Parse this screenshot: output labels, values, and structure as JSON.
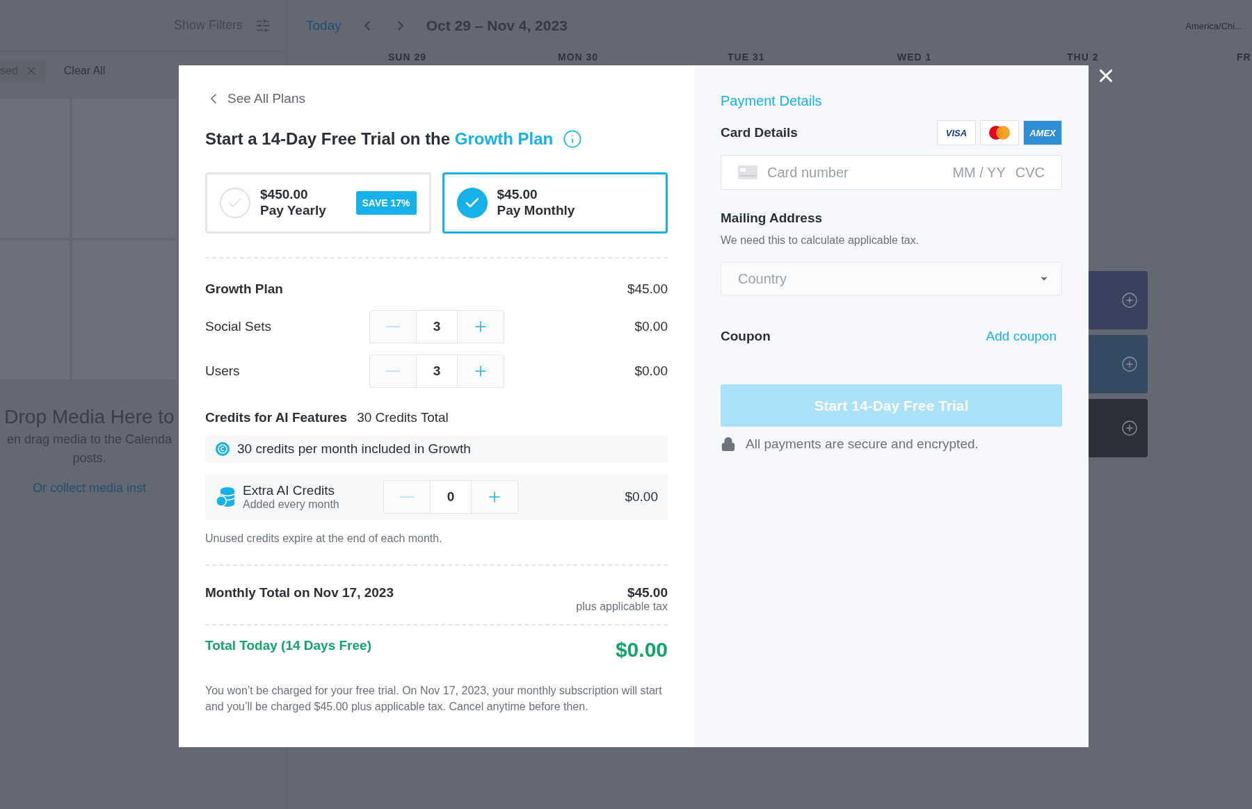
{
  "background": {
    "sidebar": {
      "show_filters": "Show Filters",
      "chip": "sed",
      "clear_all": "Clear All",
      "drop_title": "Drop Media Here to",
      "drop_lines": [
        "en drag media to the Calenda",
        "posts."
      ],
      "collect_link": "Or collect media inst"
    },
    "toolbar": {
      "today": "Today",
      "range": "Oct 29 – Nov 4, 2023",
      "timezone": "America/Chi..."
    },
    "days": [
      "SUN 29",
      "MON 30",
      "TUE 31",
      "WED 1",
      "THU 2",
      "FR"
    ],
    "slots": [
      {
        "color": "#3b4260"
      },
      {
        "color": "#344a63"
      },
      {
        "color": "#2d3038"
      }
    ]
  },
  "modal": {
    "back_link": "See All Plans",
    "title": "Start a 14-Day Free Trial on the",
    "title_highlight": "Growth Plan",
    "billing_options": [
      {
        "price": "$450.00",
        "label": "Pay Yearly",
        "badge": "SAVE 17%",
        "selected": false
      },
      {
        "price": "$45.00",
        "label": "Pay Monthly",
        "selected": true
      }
    ],
    "line_items": [
      {
        "kind": "plan",
        "label": "Growth Plan",
        "amount": "$45.00"
      },
      {
        "kind": "stepper",
        "label": "Social Sets",
        "quantity": "3",
        "amount": "$0.00"
      },
      {
        "kind": "stepper",
        "label": "Users",
        "quantity": "3",
        "amount": "$0.00"
      }
    ],
    "credits": {
      "title": "Credits for AI Features",
      "total": "30 Credits Total",
      "included": "30 credits per month included in Growth",
      "extra": {
        "title": "Extra AI Credits",
        "subtitle": "Added every month",
        "quantity": "0",
        "amount": "$0.00"
      },
      "note": "Unused credits expire at the end of each month."
    },
    "monthly_total": {
      "label": "Monthly Total on Nov 17, 2023",
      "amount": "$45.00",
      "note": "plus applicable tax"
    },
    "total_today": {
      "label": "Total Today (14 Days Free)",
      "amount": "$0.00"
    },
    "disclaimer": "You won’t be charged for your free trial. On Nov 17, 2023, your monthly subscription will start and you’ll be charged $45.00 plus applicable tax. Cancel anytime before then."
  },
  "payment": {
    "heading": "Payment Details",
    "card_label": "Card Details",
    "card_brands": [
      {
        "kind": "visa",
        "label": "VISA"
      },
      {
        "kind": "mastercard"
      },
      {
        "kind": "amex",
        "label": "AMEX"
      }
    ],
    "card_number_placeholder": "Card number",
    "expiry_placeholder": "MM / YY",
    "cvc_placeholder": "CVC",
    "mailing_label": "Mailing Address",
    "mailing_hint": "We need this to calculate applicable tax.",
    "country_placeholder": "Country",
    "coupon_label": "Coupon",
    "add_coupon": "Add coupon",
    "submit": {
      "label": "Start 14-Day Free Trial",
      "disabled": true
    },
    "secure_note": "All payments are secure and encrypted."
  }
}
